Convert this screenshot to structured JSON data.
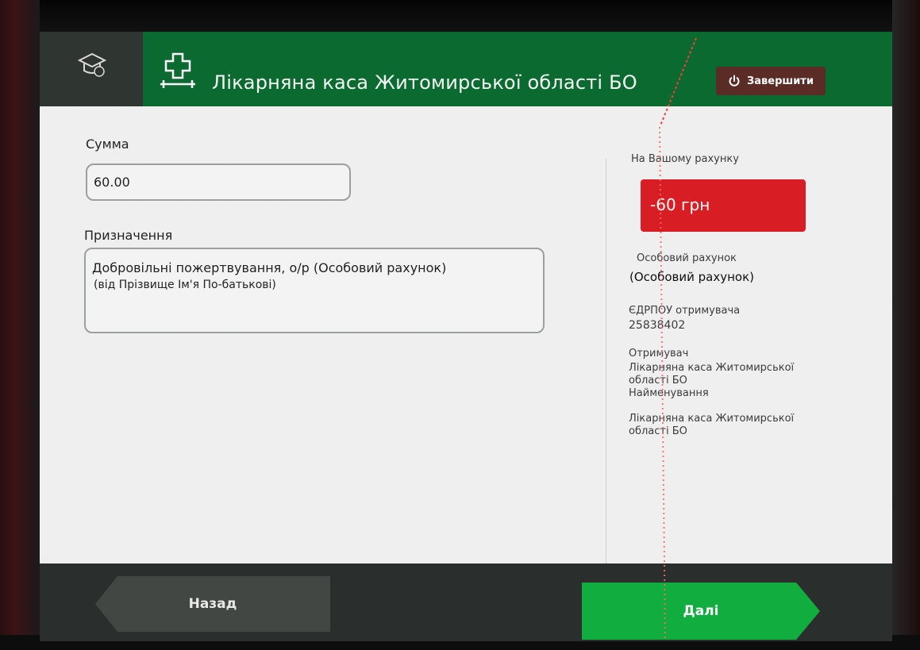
{
  "header": {
    "title": "Лікарняна каса Житомирської області БО",
    "finish_label": "Завершити"
  },
  "form": {
    "amount_label": "Сумма",
    "amount_value": "60.00",
    "purpose_label": "Призначення",
    "purpose_line1": "Добровільні пожертвування, о/р (Особовий рахунок)",
    "purpose_line2": "(від Прізвище Ім'я По-батькові)"
  },
  "side": {
    "balance_label": "На Вашому рахунку",
    "balance_value": "-60 грн",
    "account_label": "Особовий рахунок",
    "account_value": "(Особовий рахунок)",
    "edrpou_label": "ЄДРПОУ отримувача",
    "edrpou_value": "25838402",
    "recipient_label": "Отримувач",
    "recipient_value_1": "Лікарняна каса Житомирської",
    "recipient_value_2": "області БО",
    "name_label": "Найменування",
    "name_value_1": "Лікарняна каса Житомирської",
    "name_value_2": "області БО"
  },
  "footer": {
    "back_label": "Назад",
    "next_label": "Далі"
  },
  "icons": {
    "header_left": "graduation-cap-icon",
    "header_title": "medical-cross-icon",
    "finish": "power-icon"
  },
  "colors": {
    "header_green": "#0b6a30",
    "balance_red": "#d81e24",
    "next_green": "#12ad3f",
    "back_gray": "#424744",
    "finish_brown": "#5b2b26"
  }
}
